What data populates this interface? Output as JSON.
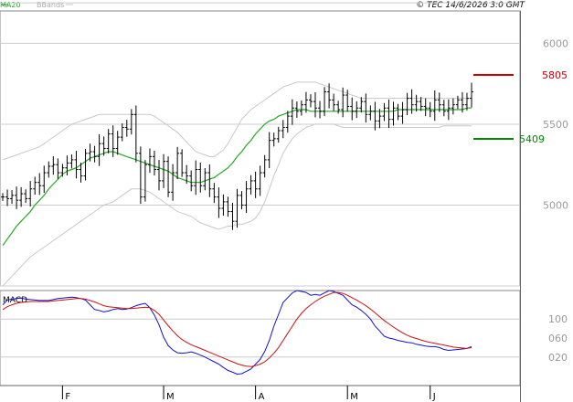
{
  "header": {
    "legend_ma": "MA20",
    "legend_bb": "BBands",
    "copyright": "© TEC 14/6/2026 3:0 GMT"
  },
  "colors": {
    "price": "#000000",
    "ma20": "#22aa22",
    "bbands": "#c8c8c8",
    "resistance": "#cc0000",
    "support": "#008800",
    "macd": "#1111cc",
    "signal": "#cc1111",
    "grid": "#cccccc"
  },
  "chart_data": [
    {
      "type": "ohlc",
      "name": "price",
      "y_ticks": [
        "6000",
        "5500",
        "5000"
      ],
      "y_tick_values": [
        6000,
        5500,
        5000
      ],
      "ylim": [
        4500,
        6200
      ],
      "x_labels": [
        "F",
        "M",
        "A",
        "M",
        "J"
      ],
      "x_label_index": [
        13,
        35,
        55,
        75,
        93
      ],
      "n_bars": 103,
      "levels": [
        {
          "label": "5805",
          "value": 5805,
          "kind": "resistance"
        },
        {
          "label": "5409",
          "value": 5409,
          "kind": "support"
        }
      ],
      "close": [
        5050,
        5040,
        5060,
        5030,
        5070,
        5040,
        5100,
        5140,
        5120,
        5200,
        5240,
        5250,
        5200,
        5230,
        5260,
        5280,
        5220,
        5180,
        5320,
        5330,
        5300,
        5380,
        5350,
        5440,
        5350,
        5420,
        5480,
        5470,
        5560,
        5320,
        5050,
        5250,
        5300,
        5220,
        5150,
        5270,
        5080,
        5200,
        5320,
        5200,
        5180,
        5120,
        5220,
        5120,
        5200,
        5100,
        5050,
        4980,
        5020,
        4960,
        4900,
        5060,
        5000,
        5100,
        5150,
        5100,
        5200,
        5280,
        5400,
        5410,
        5460,
        5480,
        5550,
        5600,
        5580,
        5620,
        5650,
        5640,
        5600,
        5580,
        5700,
        5650,
        5620,
        5590,
        5680,
        5610,
        5580,
        5600,
        5640,
        5560,
        5580,
        5520,
        5550,
        5600,
        5530,
        5600,
        5550,
        5590,
        5660,
        5620,
        5640,
        5610,
        5600,
        5580,
        5650,
        5620,
        5580,
        5600,
        5620,
        5650,
        5620,
        5660,
        5700
      ],
      "ma20": [
        4750,
        4790,
        4830,
        4870,
        4900,
        4930,
        4960,
        5000,
        5030,
        5060,
        5100,
        5130,
        5160,
        5190,
        5210,
        5220,
        5230,
        5250,
        5270,
        5290,
        5300,
        5310,
        5320,
        5330,
        5330,
        5320,
        5310,
        5300,
        5290,
        5280,
        5270,
        5260,
        5250,
        5240,
        5230,
        5220,
        5210,
        5190,
        5170,
        5160,
        5150,
        5140,
        5140,
        5140,
        5150,
        5160,
        5170,
        5190,
        5210,
        5230,
        5260,
        5300,
        5330,
        5370,
        5400,
        5440,
        5470,
        5500,
        5520,
        5530,
        5550,
        5560,
        5570,
        5580,
        5590,
        5590,
        5590,
        5580,
        5580,
        5580,
        5580,
        5580,
        5580,
        5580,
        5580,
        5580,
        5580,
        5580,
        5580,
        5580,
        5580,
        5580,
        5580,
        5580,
        5580,
        5580,
        5590,
        5590,
        5590,
        5590,
        5590,
        5590,
        5590,
        5590,
        5590,
        5590,
        5590,
        5590,
        5590,
        5590,
        5590,
        5600,
        5600
      ],
      "bb_upper": [
        5280,
        5290,
        5300,
        5310,
        5320,
        5330,
        5340,
        5350,
        5360,
        5380,
        5400,
        5420,
        5440,
        5460,
        5480,
        5500,
        5510,
        5520,
        5530,
        5540,
        5550,
        5560,
        5560,
        5560,
        5560,
        5560,
        5560,
        5560,
        5560,
        5560,
        5560,
        5560,
        5560,
        5550,
        5530,
        5510,
        5490,
        5470,
        5450,
        5420,
        5390,
        5360,
        5330,
        5320,
        5310,
        5300,
        5300,
        5320,
        5340,
        5380,
        5430,
        5480,
        5530,
        5560,
        5590,
        5610,
        5630,
        5650,
        5670,
        5690,
        5710,
        5730,
        5740,
        5750,
        5760,
        5760,
        5760,
        5760,
        5760,
        5750,
        5740,
        5730,
        5720,
        5710,
        5700,
        5690,
        5680,
        5670,
        5660,
        5660,
        5660,
        5660,
        5660,
        5660,
        5660,
        5660,
        5660,
        5660,
        5660,
        5660,
        5660,
        5660,
        5660,
        5660,
        5660,
        5660,
        5660,
        5660,
        5660,
        5660,
        5660,
        5660,
        5660
      ],
      "bb_lower": [
        4500,
        4530,
        4560,
        4590,
        4620,
        4650,
        4680,
        4700,
        4720,
        4740,
        4760,
        4780,
        4800,
        4820,
        4840,
        4860,
        4880,
        4900,
        4920,
        4940,
        4960,
        4980,
        5000,
        5010,
        5020,
        5040,
        5060,
        5080,
        5100,
        5100,
        5100,
        5090,
        5080,
        5060,
        5040,
        5020,
        5000,
        4980,
        4960,
        4950,
        4940,
        4930,
        4910,
        4890,
        4880,
        4870,
        4860,
        4850,
        4860,
        4870,
        4870,
        4880,
        4880,
        4890,
        4900,
        4920,
        4960,
        5020,
        5100,
        5180,
        5250,
        5320,
        5370,
        5410,
        5440,
        5460,
        5480,
        5490,
        5500,
        5500,
        5500,
        5500,
        5500,
        5490,
        5480,
        5480,
        5480,
        5480,
        5480,
        5480,
        5480,
        5480,
        5480,
        5480,
        5480,
        5480,
        5480,
        5480,
        5480,
        5480,
        5480,
        5480,
        5480,
        5480,
        5480,
        5480,
        5490,
        5490,
        5490,
        5490,
        5490,
        5490,
        5490
      ]
    },
    {
      "type": "line",
      "name": "MACD",
      "title": "MACD",
      "y_ticks": [
        "100",
        "060",
        "020"
      ],
      "y_tick_values": [
        100,
        60,
        20
      ],
      "ylim": [
        -40,
        160
      ],
      "series": [
        {
          "name": "MACD",
          "values": [
            130,
            140,
            142,
            143,
            144,
            142,
            141,
            140,
            139,
            139,
            139,
            141,
            143,
            144,
            145,
            146,
            145,
            143,
            140,
            130,
            120,
            118,
            115,
            117,
            120,
            122,
            120,
            121,
            124,
            128,
            131,
            133,
            124,
            108,
            88,
            62,
            44,
            35,
            29,
            28,
            29,
            31,
            28,
            24,
            20,
            15,
            10,
            5,
            -2,
            -8,
            -12,
            -16,
            -15,
            -10,
            -5,
            5,
            15,
            32,
            55,
            85,
            110,
            135,
            145,
            155,
            160,
            158,
            156,
            150,
            152,
            150,
            155,
            160,
            158,
            154,
            150,
            140,
            130,
            125,
            118,
            110,
            100,
            85,
            75,
            64,
            60,
            58,
            55,
            53,
            51,
            50,
            47,
            45,
            43,
            42,
            42,
            40,
            36,
            34,
            35,
            36,
            37,
            38,
            42
          ]
        },
        {
          "name": "Signal",
          "values": [
            120,
            126,
            130,
            133,
            135,
            136,
            137,
            137,
            137,
            137,
            137,
            138,
            139,
            140,
            141,
            142,
            143,
            143,
            142,
            139,
            136,
            132,
            128,
            126,
            125,
            124,
            123,
            122,
            122,
            123,
            124,
            125,
            124,
            118,
            110,
            98,
            86,
            75,
            65,
            57,
            51,
            46,
            42,
            38,
            34,
            30,
            26,
            22,
            18,
            14,
            10,
            6,
            3,
            1,
            0,
            2,
            5,
            10,
            18,
            28,
            40,
            55,
            70,
            85,
            100,
            112,
            122,
            130,
            137,
            143,
            148,
            152,
            156,
            156,
            154,
            150,
            145,
            140,
            134,
            128,
            121,
            113,
            105,
            97,
            90,
            83,
            77,
            71,
            66,
            62,
            59,
            56,
            53,
            51,
            49,
            47,
            45,
            43,
            41,
            40,
            39,
            38,
            40
          ]
        }
      ]
    }
  ]
}
